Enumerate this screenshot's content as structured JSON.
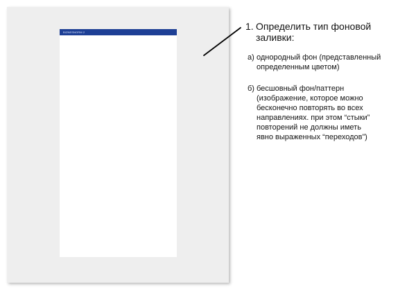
{
  "preview": {
    "logo_text": "BIZNESNORM 2"
  },
  "notes": {
    "step_number": "1.",
    "step_title": "Определить тип фоновой\nзаливки:",
    "options": [
      {
        "marker": "а)",
        "text": "однородный фон (представленный\nопределенным цветом)"
      },
      {
        "marker": "б)",
        "text": "бесшовный фон/паттерн\n(изображение, которое можно\nбесконечно повторять во всех\nнаправлениях. при этом “стыки”\nповторений не должны иметь\nявно выраженных “переходов”)"
      }
    ]
  },
  "colors": {
    "canvas_background": "#eeeeee",
    "page_background": "#ffffff",
    "header_blue": "#1d3f95",
    "text": "#111111"
  }
}
